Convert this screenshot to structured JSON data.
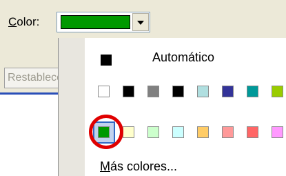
{
  "toolbar": {
    "color_label_first": "C",
    "color_label_rest": "olor:",
    "selected_color": "#009900"
  },
  "restablecer_button": {
    "label": "Restablecer"
  },
  "popup": {
    "automatic_label": "Automático",
    "more_colors_first": "M",
    "more_colors_rest": "ás colores...",
    "row1_colors": [
      "#ffffff",
      "#000000",
      "#808080",
      "#000000",
      "#b0dfe0",
      "#333399",
      "#009999",
      "#99cc00"
    ],
    "row2_colors": [
      "#009900",
      "#ffffcc",
      "#ccffcc",
      "#ccffff",
      "#ffcc66",
      "#ff9999",
      "#ff6666",
      "#ff99ff"
    ],
    "highlight_color": "#e00000"
  }
}
